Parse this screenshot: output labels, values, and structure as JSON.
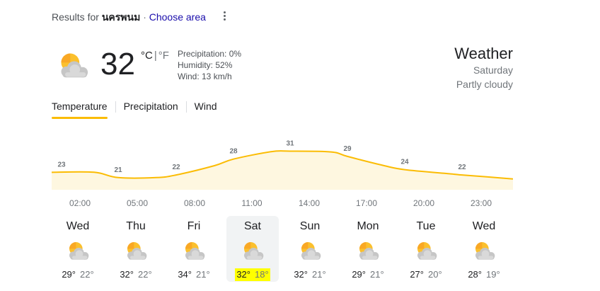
{
  "header": {
    "results_prefix": "Results for",
    "location": "นครพนม",
    "separator": "·",
    "choose_area": "Choose area",
    "more_options_icon": "more-vert-icon"
  },
  "current": {
    "icon": "partly-cloudy-icon",
    "temp": "32",
    "unit_c": "°C",
    "unit_sep": "|",
    "unit_f": "°F",
    "precipitation": "Precipitation: 0%",
    "humidity": "Humidity: 52%",
    "wind": "Wind: 13 km/h"
  },
  "summary": {
    "title": "Weather",
    "day": "Saturday",
    "condition": "Partly cloudy"
  },
  "tabs": [
    "Temperature",
    "Precipitation",
    "Wind"
  ],
  "colors": {
    "accent": "#fbbc04",
    "area_fill": "#fef7e0",
    "selected_day_bg": "#f1f3f4",
    "highlight": "#ffff00"
  },
  "hourly": {
    "temps": [
      23,
      21,
      22,
      28,
      31,
      29,
      24,
      22
    ],
    "times": [
      "02:00",
      "05:00",
      "08:00",
      "11:00",
      "14:00",
      "17:00",
      "20:00",
      "23:00"
    ]
  },
  "days": [
    {
      "name": "Wed",
      "icon": "partly-cloudy-icon",
      "high": "29°",
      "low": "22°"
    },
    {
      "name": "Thu",
      "icon": "partly-cloudy-icon",
      "high": "32°",
      "low": "22°"
    },
    {
      "name": "Fri",
      "icon": "partly-cloudy-icon",
      "high": "34°",
      "low": "21°"
    },
    {
      "name": "Sat",
      "icon": "partly-cloudy-icon",
      "high": "32°",
      "low": "18°",
      "selected": true
    },
    {
      "name": "Sun",
      "icon": "partly-cloudy-icon",
      "high": "32°",
      "low": "21°"
    },
    {
      "name": "Mon",
      "icon": "partly-cloudy-icon",
      "high": "29°",
      "low": "21°"
    },
    {
      "name": "Tue",
      "icon": "partly-cloudy-icon",
      "high": "27°",
      "low": "20°"
    },
    {
      "name": "Wed",
      "icon": "partly-cloudy-icon",
      "high": "28°",
      "low": "19°"
    }
  ]
}
